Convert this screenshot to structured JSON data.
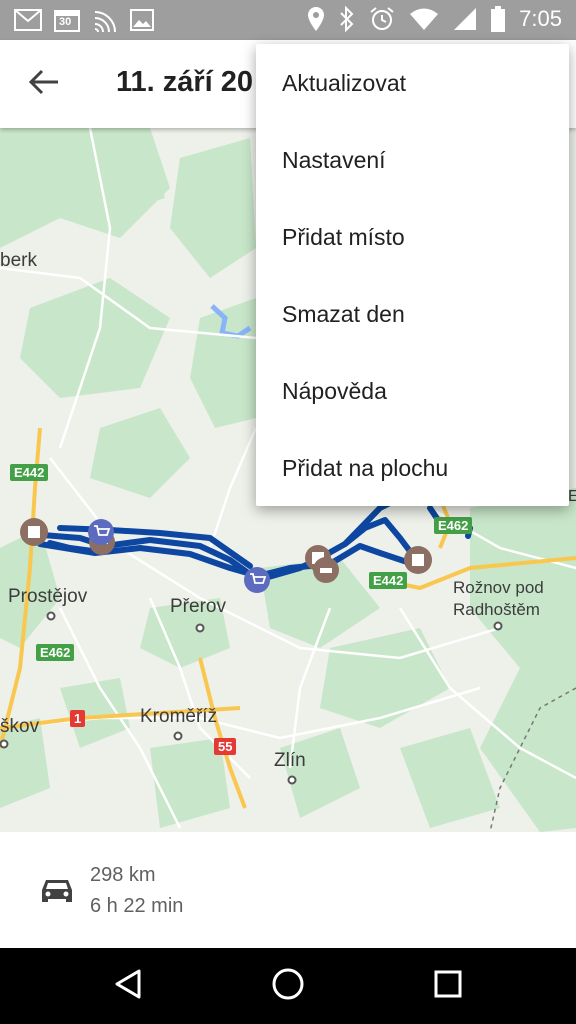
{
  "status_bar": {
    "time": "7:05",
    "left_icons": [
      "gmail-icon",
      "calendar-icon",
      "cast-icon",
      "image-icon"
    ],
    "calendar_day": "30",
    "right_icons": [
      "location-icon",
      "bluetooth-icon",
      "alarm-icon",
      "wifi-icon",
      "signal-icon",
      "battery-icon"
    ]
  },
  "app_bar": {
    "back_icon": "arrow-back-icon",
    "title": "11. září 20"
  },
  "overflow_menu": {
    "items": [
      {
        "label": "Aktualizovat"
      },
      {
        "label": "Nastavení"
      },
      {
        "label": "Přidat místo"
      },
      {
        "label": "Smazat den"
      },
      {
        "label": "Nápověda"
      },
      {
        "label": "Přidat na plochu"
      }
    ]
  },
  "map": {
    "labels": {
      "sternberk_partial": "berk",
      "prostejov": "Prostějov",
      "prerov": "Přerov",
      "roznov_line1": "Rožnov pod",
      "roznov_line2": "Radhoštěm",
      "kromeriz": "Kroměříž",
      "zlin": "Zlín",
      "vyskov_partial": "škov"
    },
    "road_shields": {
      "e442_left": "E442",
      "e462_left": "E462",
      "e442_right": "E442",
      "e462_right": "E462",
      "road_1": "1",
      "road_55": "55",
      "edge_e": "E"
    },
    "colors": {
      "route": "#0d47a1",
      "stop_marker": "#8d6e63",
      "shop_marker": "#5c6bc0",
      "forest": "#c8e6c9",
      "motorway": "#f9c74f"
    }
  },
  "summary": {
    "car_icon": "car-icon",
    "distance": "298 km",
    "duration": "6 h 22 min"
  },
  "nav_bar": {
    "icons": [
      "back-triangle-icon",
      "home-circle-icon",
      "recents-square-icon"
    ]
  }
}
